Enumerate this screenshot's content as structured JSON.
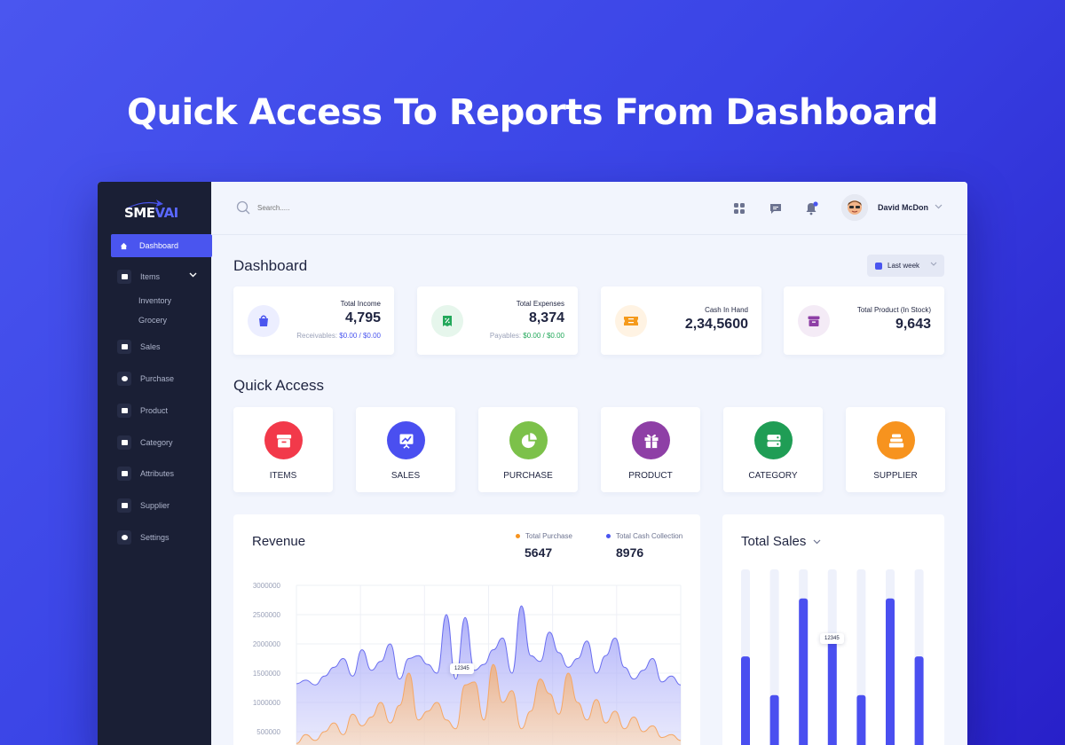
{
  "hero": {
    "title": "Quick Access To Reports From Dashboard"
  },
  "brand": {
    "logo_left": "SME",
    "logo_right": "VAI"
  },
  "sidebar": {
    "items": [
      {
        "label": "Dashboard",
        "icon": "home-icon",
        "active": true
      },
      {
        "label": "Items",
        "icon": "box-icon",
        "expanded": true
      },
      {
        "label": "Sales",
        "icon": "cart-icon"
      },
      {
        "label": "Purchase",
        "icon": "pie-icon"
      },
      {
        "label": "Product",
        "icon": "gift-icon"
      },
      {
        "label": "Category",
        "icon": "category-icon"
      },
      {
        "label": "Attributes",
        "icon": "database-icon"
      },
      {
        "label": "Supplier",
        "icon": "stack-icon"
      },
      {
        "label": "Settings",
        "icon": "gear-icon"
      }
    ],
    "subitems": [
      "Inventory",
      "Grocery"
    ]
  },
  "topbar": {
    "search_placeholder": "Search.....",
    "username": "David McDon"
  },
  "main": {
    "title": "Dashboard",
    "range": "Last week",
    "stats": [
      {
        "label": "Total Income",
        "value": "4,795",
        "sub_label": "Receivables:",
        "sub_value": "$0.00 / $0.00",
        "color": "#4a55ef",
        "bg": "#eceeff"
      },
      {
        "label": "Total Expenses",
        "value": "8,374",
        "sub_label": "Payables:",
        "sub_value": "$0.00 / $0.00",
        "color": "#22a85a",
        "bg": "#e6f6ec"
      },
      {
        "label": "Cash In Hand",
        "value": "2,34,5600",
        "color": "#f59a1b",
        "bg": "#fff3e3"
      },
      {
        "label": "Total Product (In Stock)",
        "value": "9,643",
        "color": "#8e3fa6",
        "bg": "#f4ebf6"
      }
    ],
    "quick_access_title": "Quick Access",
    "quick_access": [
      {
        "label": "ITEMS",
        "icon": "archive-icon",
        "color": "#f2394a"
      },
      {
        "label": "SALES",
        "icon": "presentation-icon",
        "color": "#4a4ff0"
      },
      {
        "label": "PURCHASE",
        "icon": "pie-chart-icon",
        "color": "#7cc14a"
      },
      {
        "label": "PRODUCT",
        "icon": "gift-icon",
        "color": "#8e3fa6"
      },
      {
        "label": "CATEGORY",
        "icon": "server-icon",
        "color": "#1f9d55"
      },
      {
        "label": "SUPPLIER",
        "icon": "stack-icon",
        "color": "#f7931e"
      }
    ]
  },
  "revenue": {
    "title": "Revenue",
    "legend": [
      {
        "label": "Total Purchase",
        "value": "5647",
        "color": "#f7931e"
      },
      {
        "label": "Total Cash Collection",
        "value": "8976",
        "color": "#4a55ef"
      }
    ],
    "tooltip": "12345"
  },
  "total_sales": {
    "title": "Total Sales",
    "tooltip": "12345"
  },
  "chart_data": [
    {
      "type": "area",
      "ylim": [
        0,
        3000000
      ],
      "yticks": [
        "500000",
        "1000000",
        "1500000",
        "2000000",
        "2500000",
        "3000000"
      ],
      "series": [
        {
          "name": "Total Cash Collection",
          "color": "#7c7ff5",
          "values": [
            1320000,
            1380000,
            1300000,
            1450000,
            1600000,
            1750000,
            1450000,
            1900000,
            1550000,
            1700000,
            2000000,
            1400000,
            1750000,
            1800000,
            1650000,
            1500000,
            2500000,
            1400000,
            2450000,
            1550000,
            1650000,
            1900000,
            2100000,
            1500000,
            2650000,
            1800000,
            1700000,
            2200000,
            1850000,
            1600000,
            1750000,
            2050000,
            1500000,
            1800000,
            2100000,
            1600000,
            1400000,
            1550000,
            1750000,
            1350000,
            1450000,
            1300000
          ]
        },
        {
          "name": "Total Purchase",
          "color": "#f8b87a",
          "values": [
            300000,
            450000,
            350000,
            500000,
            650000,
            450000,
            800000,
            600000,
            750000,
            1000000,
            650000,
            950000,
            1500000,
            700000,
            850000,
            1000000,
            700000,
            550000,
            1300000,
            1350000,
            700000,
            1650000,
            1000000,
            1200000,
            550000,
            850000,
            1400000,
            1150000,
            800000,
            1500000,
            1000000,
            700000,
            1050000,
            650000,
            850000,
            550000,
            750000,
            500000,
            600000,
            400000,
            450000,
            350000
          ]
        }
      ]
    },
    {
      "type": "bar",
      "series": [
        {
          "name": "Total Sales",
          "values": [
            0.55,
            0.35,
            0.85,
            0.65,
            0.35,
            0.85,
            0.55
          ]
        }
      ]
    }
  ]
}
